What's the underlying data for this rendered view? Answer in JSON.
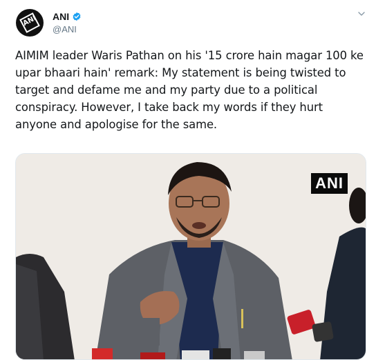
{
  "tweet": {
    "author": {
      "display_name": "ANI",
      "handle": "@ANI",
      "verified": true,
      "avatar_logo_text": "ANI"
    },
    "text": "AIMIM leader Waris Pathan on his '15 crore hain magar 100 ke upar bhaari hain' remark: My statement is being twisted to target and defame me and my party due to a political conspiracy. However, I take back my words if they hurt anyone and apologise for the same.",
    "media": {
      "watermark": "ANI"
    }
  },
  "colors": {
    "verified_badge": "#1da1f2",
    "handle_gray": "#657786",
    "text": "#14171a"
  }
}
